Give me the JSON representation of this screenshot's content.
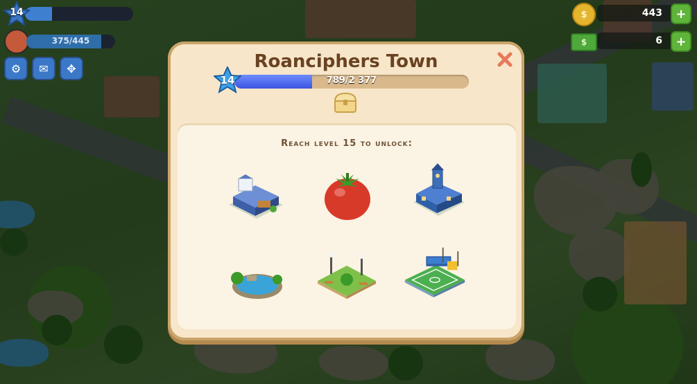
{
  "hud": {
    "level": "14",
    "level_progress": 0.25,
    "population": "375/445",
    "population_fraction": 0.84,
    "coins": "443",
    "cash": "6"
  },
  "dialog": {
    "title": "Roanciphers Town",
    "level": "14",
    "xp": "789/2 377",
    "xp_fraction": 0.332,
    "unlock_text": "Reach level 15 to unlock:"
  },
  "unlock_items": [
    {
      "name": "Factory building"
    },
    {
      "name": "Tomato"
    },
    {
      "name": "School building"
    },
    {
      "name": "Pond"
    },
    {
      "name": "Park"
    },
    {
      "name": "Soccer field"
    }
  ],
  "colors": {
    "dialog_bg": "#f7e6c9",
    "title": "#6a4222",
    "xp_fill": "#3d55e0",
    "close": "#e57a5a",
    "plus": "#5fb43a"
  },
  "icons": {
    "settings": "gear-icon",
    "mail": "mail-icon",
    "move": "move-arrows-icon",
    "close": "close-icon",
    "chest": "chest-icon",
    "coin": "coin-icon",
    "cash": "cash-icon"
  }
}
